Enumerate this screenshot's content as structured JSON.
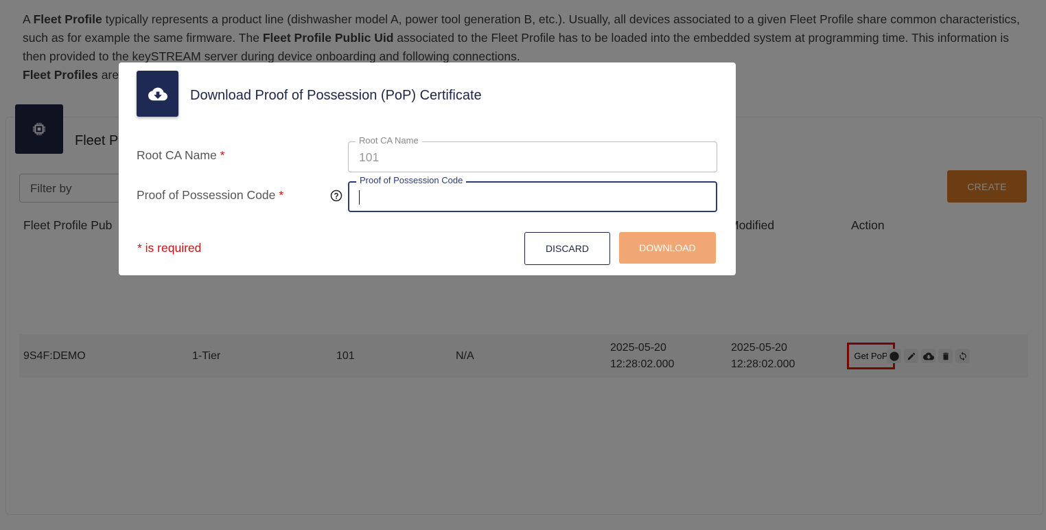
{
  "intro": {
    "p1_term": "Fleet Profile",
    "p1_a": "A ",
    "p1_b": " typically represents a product line (dishwasher model A, power tool generation B, etc.). Usually, all devices associated to a given Fleet Profile share common characteristics, such as for example the same firmware. The ",
    "p1_term2": "Fleet Profile Public Uid",
    "p1_c": " associated to the Fleet Profile has to be loaded into the embedded system at programming time. This information is then provided to the keySTREAM server during device onboarding and following connections.",
    "p2_term": "Fleet Profiles",
    "p2_a": " are"
  },
  "card": {
    "title": "Fleet P",
    "filter_label": "Filter by",
    "create_label": "CREATE",
    "icon": "chip-icon"
  },
  "table": {
    "headers": {
      "public_uid": "Fleet Profile Pub",
      "modified": "Modified",
      "action": "Action"
    },
    "row": {
      "public_uid": "9S4F:DEMO",
      "tier": "1-Tier",
      "root_ca": "101",
      "col4": "N/A",
      "created_date": "2025-05-20",
      "created_time": "12:28:02.000",
      "modified_date": "2025-05-20",
      "modified_time": "12:28:02.000",
      "get_pop_label": "Get PoP"
    },
    "action_icons": [
      "info-icon",
      "pencil-icon",
      "cloud-download-icon",
      "trash-icon",
      "refresh-icon"
    ]
  },
  "modal": {
    "icon": "cloud-download-icon",
    "title": "Download Proof of Possession (PoP) Certificate",
    "root_ca_label": "Root CA Name",
    "pop_code_label": "Proof of Possession Code",
    "required_star": "*",
    "root_ca_field": {
      "legend": "Root CA Name",
      "value": "101"
    },
    "pop_code_field": {
      "legend": "Proof of Possession Code",
      "value": ""
    },
    "required_note": "* is required",
    "discard_label": "DISCARD",
    "download_label": "DOWNLOAD"
  },
  "colors": {
    "navy": "#1e2a54",
    "create_orange": "#d97a27",
    "download_orange": "#f0a773",
    "required_red": "#d01010",
    "highlight_red": "#e01010"
  }
}
